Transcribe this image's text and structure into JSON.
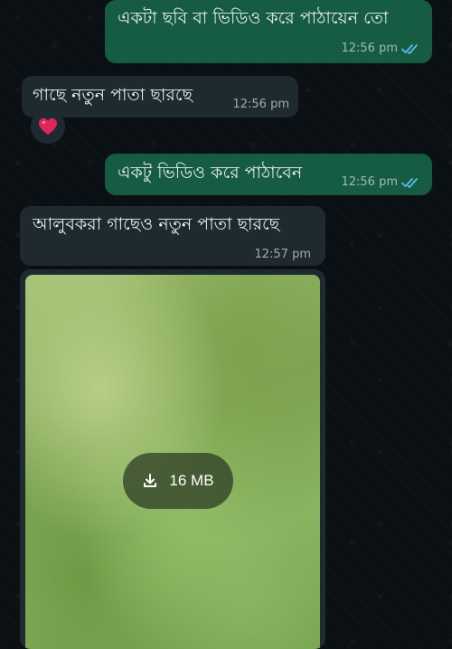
{
  "messages": [
    {
      "text": "একটা ছবি বা ভিডিও করে পাঠায়েন তো",
      "time": "12:56 pm"
    },
    {
      "text": "গাছে নতুন পাতা ছারছে",
      "time": "12:56 pm",
      "reaction": "heart-icon"
    },
    {
      "text": "একটু ভিডিও করে পাঠাবেন",
      "time": "12:56 pm"
    },
    {
      "text": "আলুবকরা গাছেও নতুন পাতা ছারছে",
      "time": "12:57 pm"
    }
  ],
  "video": {
    "size": "16 MB"
  },
  "colors": {
    "outgoing_bubble": "#155c42",
    "incoming_bubble": "#1f2a30",
    "read_ticks": "#53bdeb",
    "heart": "#e0245e",
    "background": "#0b1014"
  }
}
